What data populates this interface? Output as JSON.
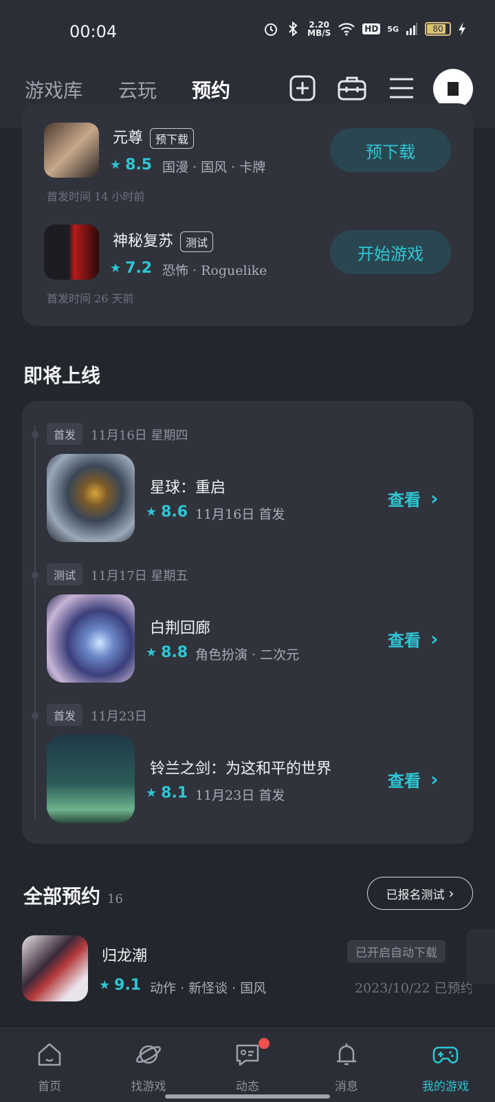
{
  "status_bar": {
    "time": "00:04",
    "net_speed_value": "2.20",
    "net_speed_unit": "MB/S",
    "hd": "HD",
    "signal": "5G",
    "battery": "80"
  },
  "top_nav": {
    "tabs": [
      {
        "label": "游戏库"
      },
      {
        "label": "云玩"
      },
      {
        "label": "预约"
      }
    ],
    "active_tab": "预约"
  },
  "reserved_games": [
    {
      "name": "元尊",
      "tag": "预下载",
      "rating": "8.5",
      "genres": "国漫 · 国风 · 卡牌",
      "release_info": "首发时间 14 小时前",
      "action": "预下载"
    },
    {
      "name": "神秘复苏",
      "tag": "测试",
      "rating": "7.2",
      "genres": "恐怖 · Roguelike",
      "release_info": "首发时间 26 天前",
      "action": "开始游戏"
    }
  ],
  "upcoming": {
    "title": "即将上线",
    "items": [
      {
        "badge": "首发",
        "date": "11月16日  星期四",
        "name": "星球：重启",
        "rating": "8.6",
        "meta": "11月16日  首发",
        "action": "查看"
      },
      {
        "badge": "测试",
        "date": "11月17日  星期五",
        "name": "白荆回廊",
        "rating": "8.8",
        "meta": "角色扮演 · 二次元",
        "action": "查看"
      },
      {
        "badge": "首发",
        "date": "11月23日",
        "name": "铃兰之剑：为这和平的世界",
        "rating": "8.1",
        "meta": "11月23日  首发",
        "action": "查看"
      }
    ]
  },
  "all_reservations": {
    "title": "全部预约",
    "count": "16",
    "filter_button": "已报名测试",
    "items": [
      {
        "name": "归龙潮",
        "rating": "9.1",
        "genres": "动作 · 新怪谈 · 国风",
        "auto_download": "已开启自动下载",
        "reserved_date": "2023/10/22 已预约"
      }
    ]
  },
  "bottom_nav": {
    "items": [
      {
        "label": "首页"
      },
      {
        "label": "找游戏"
      },
      {
        "label": "动态"
      },
      {
        "label": "消息"
      },
      {
        "label": "我的游戏"
      }
    ],
    "active": "我的游戏"
  },
  "colors": {
    "accent": "#2fc6d4",
    "background": "#24262d",
    "card": "#30333c",
    "notification": "#f05050"
  }
}
